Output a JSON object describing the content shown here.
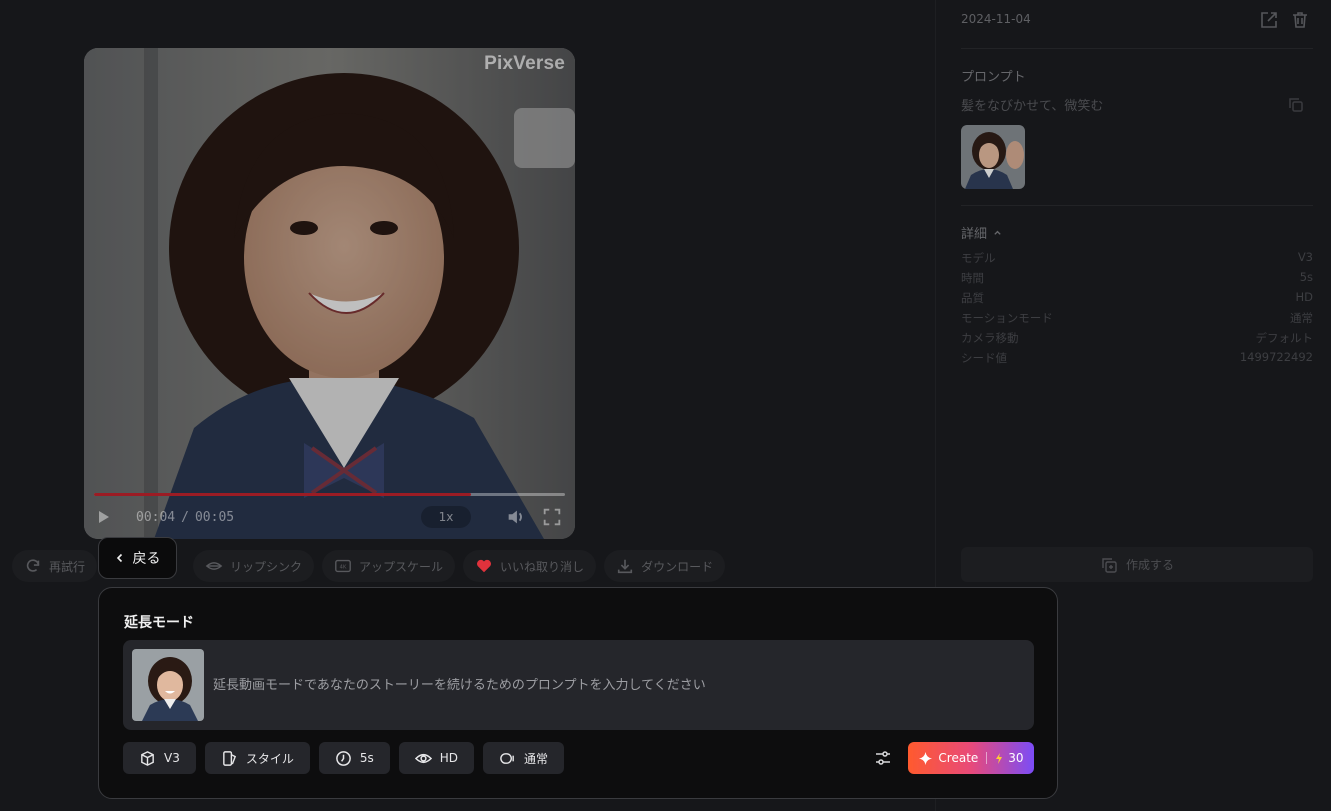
{
  "player": {
    "watermark": "PixVerse",
    "current_time": "00:04",
    "time_separator": "/",
    "total_time": "00:05",
    "speed": "1x",
    "progress": 0.8
  },
  "actions": {
    "retry": "再試行",
    "back": "戻る",
    "lipsync": "リップシンク",
    "upscale": "アップスケール",
    "unlike": "いいね取り消し",
    "download": "ダウンロード"
  },
  "dialog": {
    "title": "延長モード",
    "prompt_placeholder": "延長動画モードであなたのストーリーを続けるためのプロンプトを入力してください",
    "options": {
      "model": "V3",
      "style": "スタイル",
      "duration": "5s",
      "quality": "HD",
      "motion": "通常"
    },
    "create_label": "Create",
    "credits": "30"
  },
  "right_panel": {
    "date": "2024-11-04",
    "prompt_heading": "プロンプト",
    "prompt_text": "髪をなびかせて、微笑む",
    "details_heading": "詳細",
    "details": [
      {
        "label": "モデル",
        "value": "V3"
      },
      {
        "label": "時間",
        "value": "5s"
      },
      {
        "label": "品質",
        "value": "HD"
      },
      {
        "label": "モーションモード",
        "value": "通常"
      },
      {
        "label": "カメラ移動",
        "value": "デフォルト"
      },
      {
        "label": "シード値",
        "value": "1499722492"
      }
    ],
    "create_label": "作成する"
  },
  "colors": {
    "background": "#16171a",
    "accent_gradient_start": "#ff5a2e",
    "accent_gradient_end": "#7b4cf7",
    "progress": "#9b1c24",
    "heart": "#e0323c"
  }
}
